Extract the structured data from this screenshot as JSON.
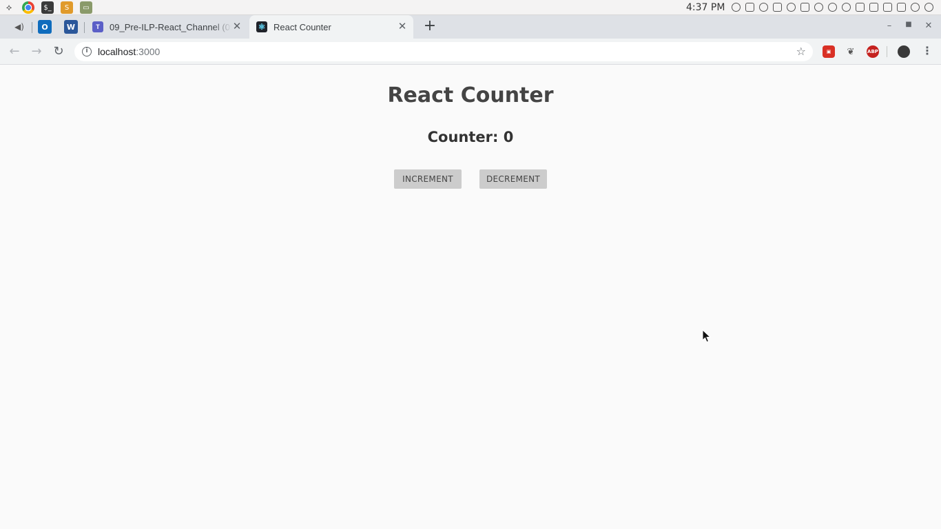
{
  "os": {
    "clock": "4:37 PM"
  },
  "browser": {
    "tabs": [
      {
        "title": "09_Pre-ILP-React_Channel (09",
        "favicon": "teams-icon",
        "active": false
      },
      {
        "title": "React Counter",
        "favicon": "react-icon",
        "active": true
      }
    ],
    "url_host": "localhost",
    "url_port": ":3000",
    "extension_abp_label": "ABP"
  },
  "page": {
    "title": "React Counter",
    "counter_label": "Counter: 0",
    "increment_label": "INCREMENT",
    "decrement_label": "DECREMENT"
  }
}
